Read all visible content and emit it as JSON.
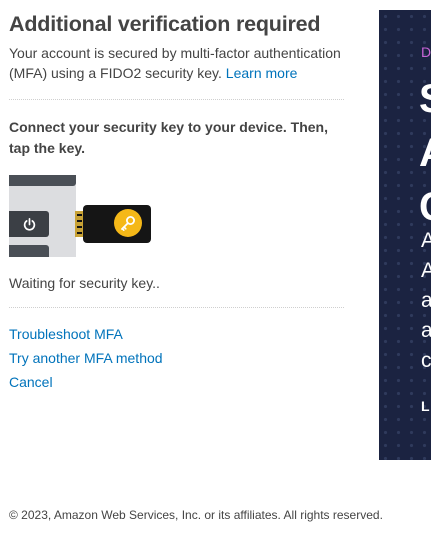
{
  "header": {
    "title": "Additional verification required",
    "description": "Your account is secured by multi-factor authentication (MFA) using a FIDO2 security key.",
    "learn_more": "Learn more"
  },
  "instruction": "Connect your security key to your device. Then, tap the key.",
  "illustration": {
    "icons": [
      "laptop",
      "power-icon",
      "security-key",
      "key-icon"
    ]
  },
  "status": "Waiting for security key..",
  "links": {
    "troubleshoot": "Troubleshoot MFA",
    "try_another": "Try another MFA method",
    "cancel": "Cancel"
  },
  "promo": {
    "eyebrow": "D",
    "headline": [
      "S",
      "A",
      "C"
    ],
    "body": [
      "A",
      "A",
      "a",
      "a",
      "c"
    ],
    "cta": "L",
    "background": "#1b2341",
    "eyebrow_color": "#c864d6"
  },
  "footer": "© 2023, Amazon Web Services, Inc. or its affiliates. All rights reserved.",
  "colors": {
    "link": "#0073bb",
    "text": "#444444"
  }
}
